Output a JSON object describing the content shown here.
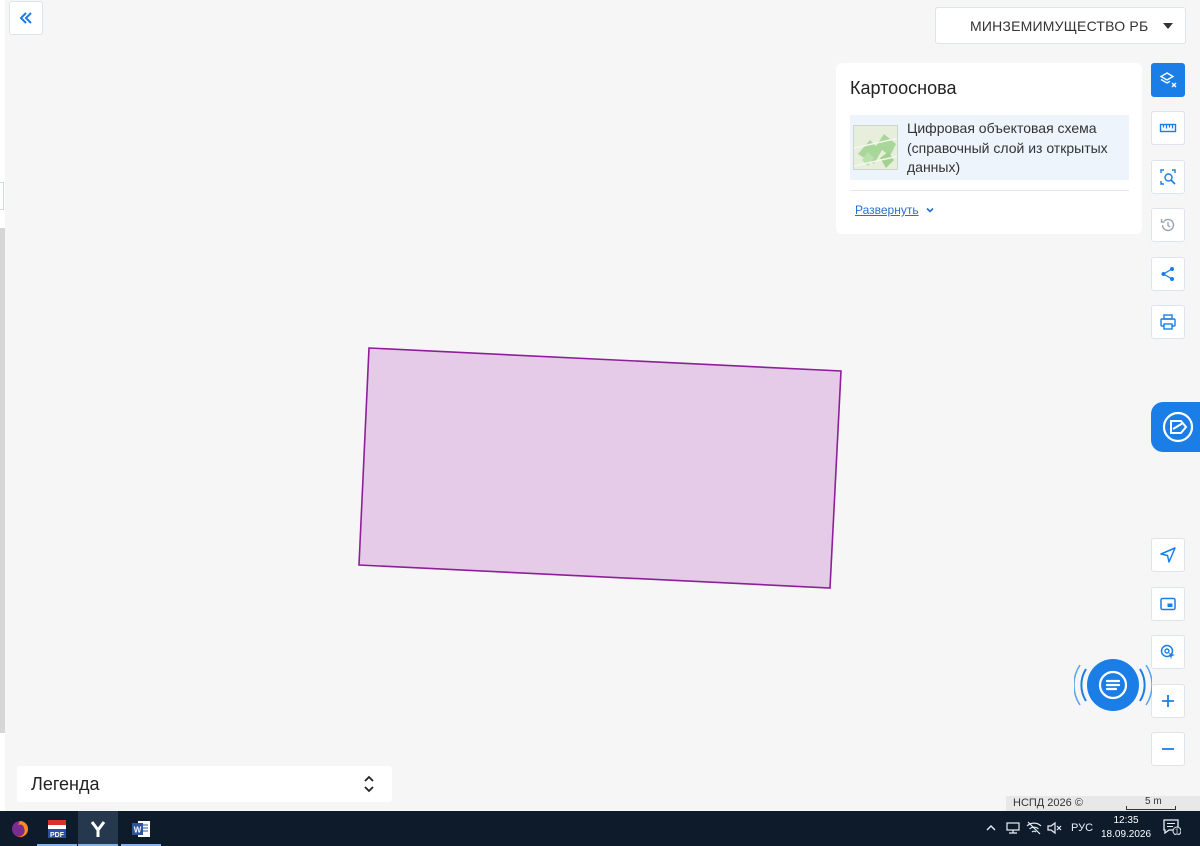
{
  "header": {
    "collapse_icon": "double-chevron-left-icon",
    "org_select_value": "МИНЗЕМИМУЩЕСТВО РБ"
  },
  "basemap": {
    "title": "Картооснова",
    "layer_label": "Цифровая объектовая схема (справочный слой из открытых данных)",
    "expand_link": "Развернуть"
  },
  "toolbar_top": [
    {
      "icon": "layers-clear-icon",
      "active": true
    },
    {
      "icon": "ruler-icon",
      "active": false
    },
    {
      "icon": "area-search-icon",
      "active": false
    },
    {
      "icon": "history-icon",
      "active": false,
      "disabled": true
    },
    {
      "icon": "share-icon",
      "active": false
    },
    {
      "icon": "print-icon",
      "active": false
    }
  ],
  "toolbar_bottom": [
    {
      "icon": "navigate-icon"
    },
    {
      "icon": "minimap-icon"
    },
    {
      "icon": "locate-icon"
    },
    {
      "icon": "zoom-in-icon"
    },
    {
      "icon": "zoom-out-icon"
    }
  ],
  "legend": {
    "label": "Легенда"
  },
  "attribution": {
    "text": "НСПД 2026 ©",
    "scale": "5 m"
  },
  "colors": {
    "accent": "#1a7ee6",
    "parcel_fill": "#e6cbe8",
    "parcel_stroke": "#8e1f9a",
    "taskbar": "#0e1b2b"
  },
  "taskbar": {
    "apps": [
      {
        "icon": "firefox-icon"
      },
      {
        "icon": "pdf-editor-icon"
      },
      {
        "icon": "yandex-browser-icon"
      },
      {
        "icon": "word-icon"
      }
    ],
    "tray": {
      "language": "РУС",
      "time": "12:35",
      "date": "18.09.2026",
      "notifications": "1"
    }
  }
}
